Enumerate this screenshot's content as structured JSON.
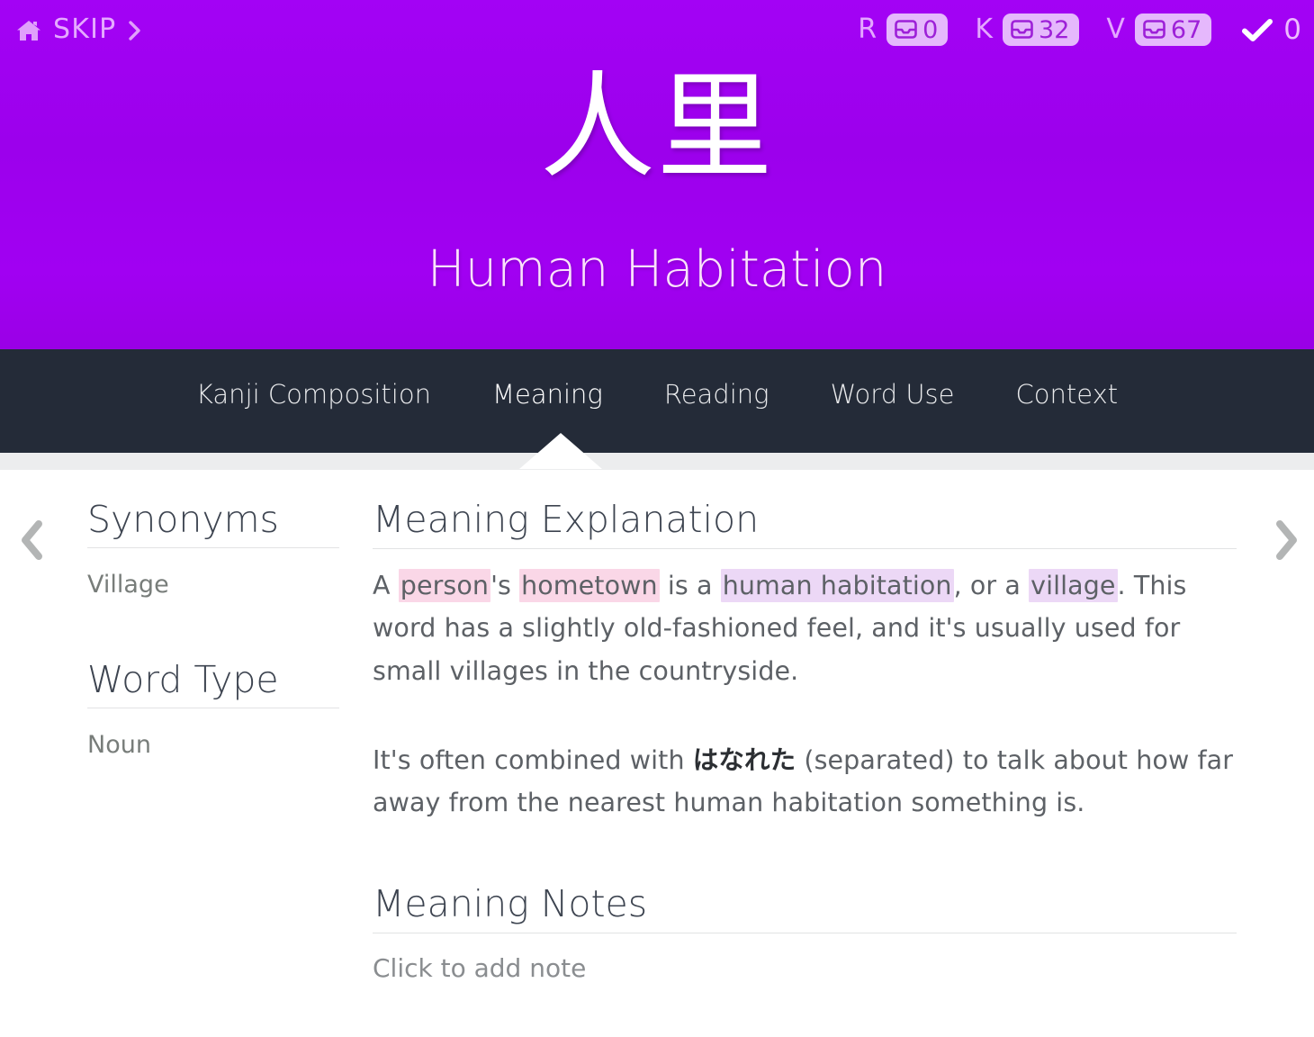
{
  "header": {
    "skip": {
      "home_icon": "home-icon",
      "label": "SKIP",
      "chevron_icon": "chevron-right-icon"
    },
    "counters": [
      {
        "letter": "R",
        "icon": "inbox-tray-icon",
        "value": "0"
      },
      {
        "letter": "K",
        "icon": "inbox-tray-icon",
        "value": "32"
      },
      {
        "letter": "V",
        "icon": "inbox-tray-icon",
        "value": "67"
      }
    ],
    "check": {
      "icon": "check-icon",
      "value": "0"
    },
    "kanji": "人里",
    "subtitle": "Human Habitation",
    "accent_color": "#9c00ec",
    "nav_bg_color": "#242b38"
  },
  "nav": {
    "tabs": [
      {
        "label": "Kanji Composition",
        "active": false
      },
      {
        "label": "Meaning",
        "active": true
      },
      {
        "label": "Reading",
        "active": false
      },
      {
        "label": "Word Use",
        "active": false
      },
      {
        "label": "Context",
        "active": false
      }
    ]
  },
  "pager": {
    "prev_icon": "chevron-left-icon",
    "next_icon": "chevron-right-icon"
  },
  "sidebar": {
    "synonyms": {
      "title": "Synonyms",
      "value": "Village"
    },
    "word_type": {
      "title": "Word Type",
      "value": "Noun"
    }
  },
  "main": {
    "explanation": {
      "title": "Meaning Explanation",
      "p1": {
        "t1": "A ",
        "h1": "person",
        "t2": "'s ",
        "h2": "hometown",
        "t3": " is a ",
        "h3": "human habitation",
        "t4": ", or a ",
        "h4": "village",
        "t5": ". This word has a slightly old-fashioned feel, and it's usually used for small villages in the countryside."
      },
      "p2": {
        "t1": "It's often combined with ",
        "jp": "はなれた",
        "t2": " (separated) to talk about how far away from the nearest human habitation something is."
      }
    },
    "notes": {
      "title": "Meaning Notes",
      "placeholder": "Click to add note"
    },
    "highlight_kanji_color": "#fad7e7",
    "highlight_vocab_color": "#ecd8f6"
  }
}
